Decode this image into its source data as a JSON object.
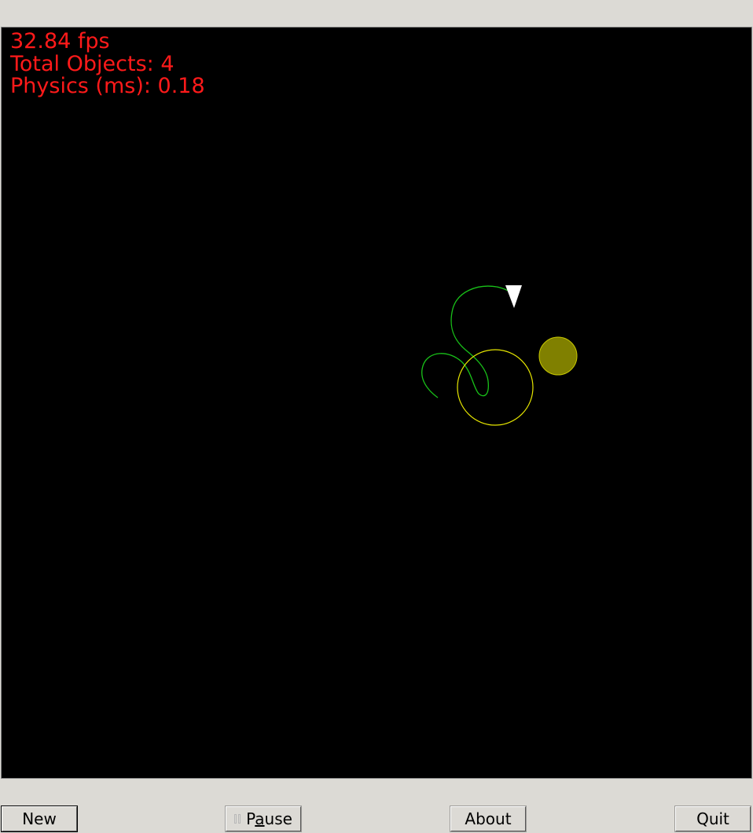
{
  "hud": {
    "fps": "32.84 fps",
    "total_objects": "Total Objects: 4",
    "physics": "Physics (ms): 0.18"
  },
  "colors": {
    "hud_text": "#ff1a1a",
    "trail": "#19c219",
    "ring": "#e6e600",
    "planet": "#808000",
    "ship": "#ffffff",
    "background": "#000000"
  },
  "buttons": {
    "new": "New",
    "pause_prefix": "P",
    "pause_mnemonic": "a",
    "pause_suffix": "use",
    "about": "About",
    "quit": "Quit"
  }
}
